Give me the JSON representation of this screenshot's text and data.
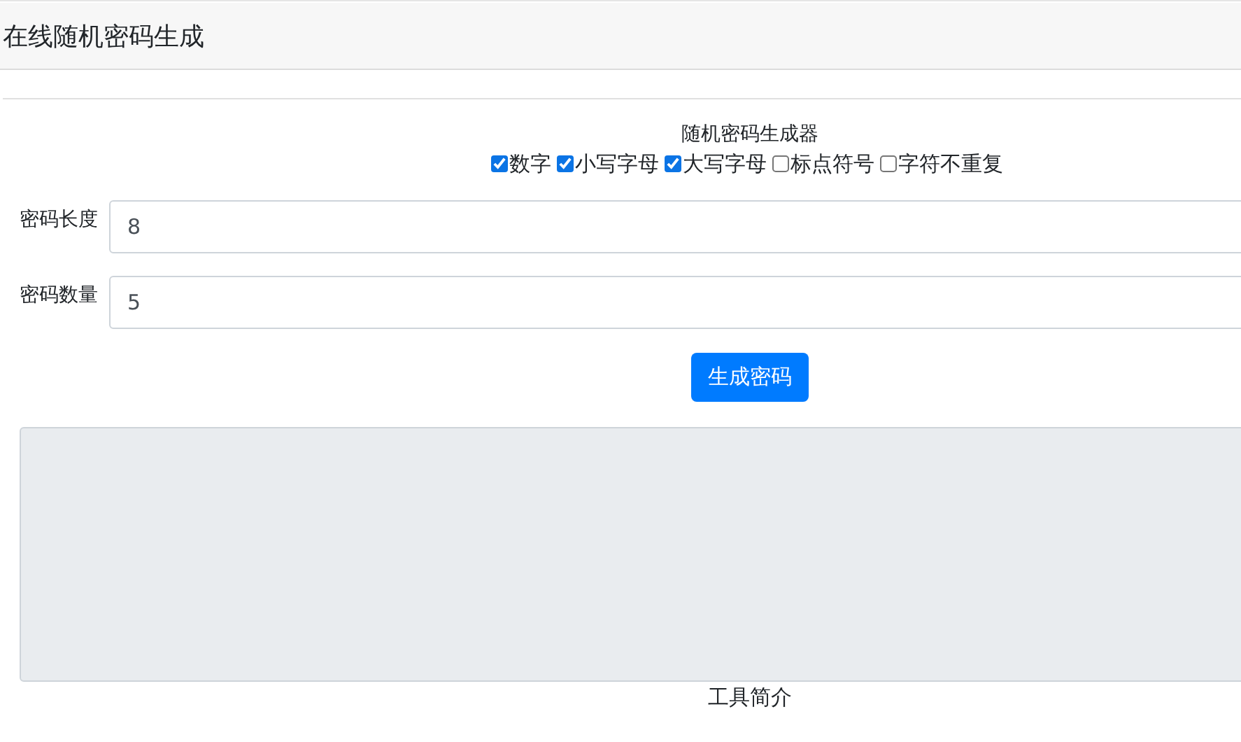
{
  "header": {
    "title": "在线随机密码生成"
  },
  "generator": {
    "title": "随机密码生成器",
    "options": [
      {
        "label": "数字",
        "checked": true
      },
      {
        "label": "小写字母",
        "checked": true
      },
      {
        "label": "大写字母",
        "checked": true
      },
      {
        "label": "标点符号",
        "checked": false
      },
      {
        "label": "字符不重复",
        "checked": false
      }
    ],
    "fields": [
      {
        "label": "密码长度",
        "value": "8"
      },
      {
        "label": "密码数量",
        "value": "5"
      }
    ],
    "button": "生成密码"
  },
  "intro": {
    "title": "工具简介"
  }
}
